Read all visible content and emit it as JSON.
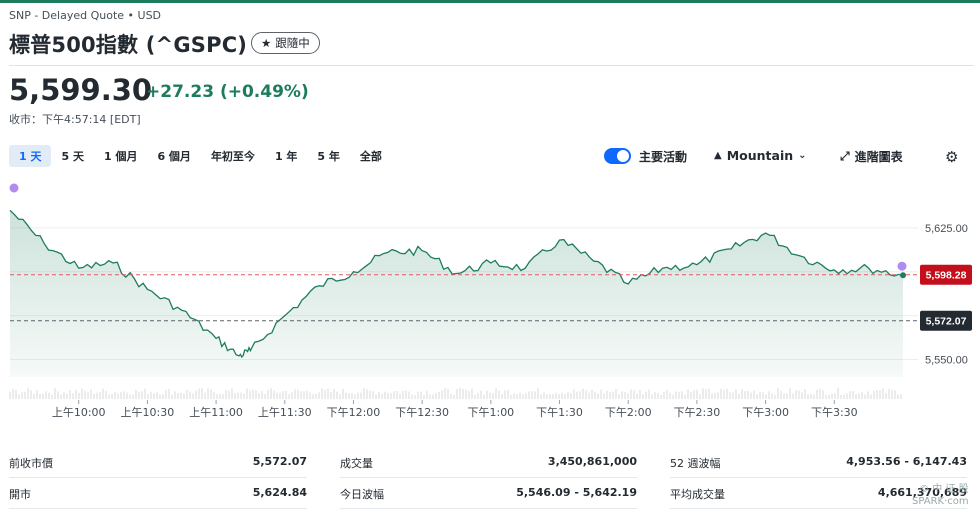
{
  "header": {
    "exchange": "SNP - Delayed Quote • USD",
    "title": "標普500指數 (^GSPC)",
    "follow_label": "跟隨中",
    "price": "5,599.30",
    "change": "+27.23",
    "change_pct": "(+0.49%)",
    "market_status": "收市：下午4:57:14 [EDT]"
  },
  "ranges": [
    {
      "label": "1 天",
      "active": true
    },
    {
      "label": "5 天",
      "active": false
    },
    {
      "label": "1 個月",
      "active": false
    },
    {
      "label": "6 個月",
      "active": false
    },
    {
      "label": "年初至今",
      "active": false
    },
    {
      "label": "1 年",
      "active": false
    },
    {
      "label": "5 年",
      "active": false
    },
    {
      "label": "全部",
      "active": false
    }
  ],
  "controls": {
    "toggle_label": "主要活動",
    "chart_type": "Mountain",
    "advanced": "進階圖表"
  },
  "colors": {
    "up": "#1d7c5e",
    "accent": "#0f69ff",
    "current_price_flag": "#c30f1c",
    "prev_close_flag": "#232a31",
    "event_dot": "#b18cf0"
  },
  "chart_data": {
    "type": "area",
    "ylim": [
      5540,
      5650
    ],
    "y_ticks": [
      {
        "value": 5625,
        "label": "5,625.00"
      },
      {
        "value": 5550,
        "label": "5,550.00"
      }
    ],
    "x_ticks": [
      "上午10:00",
      "上午10:30",
      "上午11:00",
      "上午11:30",
      "下午12:00",
      "下午12:30",
      "下午1:00",
      "下午1:30",
      "下午2:00",
      "下午2:30",
      "下午3:00",
      "下午3:30"
    ],
    "current_price": {
      "value": 5598.28,
      "label": "5,598.28"
    },
    "previous_close": {
      "value": 5572.07,
      "label": "5,572.07"
    },
    "series": [
      {
        "x": [
          "09:30",
          "09:45",
          "10:00",
          "10:15",
          "10:30",
          "10:45",
          "11:00",
          "11:10",
          "11:15",
          "11:30",
          "11:45",
          "12:00",
          "12:15",
          "12:30",
          "12:45",
          "13:00",
          "13:15",
          "13:30",
          "13:45",
          "14:00",
          "14:15",
          "14:30",
          "14:45",
          "15:00",
          "15:15",
          "15:30",
          "15:45",
          "16:00"
        ],
        "values": [
          5635,
          5616,
          5602,
          5605,
          5590,
          5578,
          5562,
          5552,
          5555,
          5575,
          5592,
          5600,
          5611,
          5612,
          5599,
          5605,
          5602,
          5618,
          5606,
          5593,
          5602,
          5604,
          5613,
          5622,
          5609,
          5601,
          5602,
          5598
        ]
      }
    ]
  },
  "stats": [
    {
      "label": "前收市價",
      "value": "5,572.07"
    },
    {
      "label": "開市",
      "value": "5,624.84"
    },
    {
      "label": "成交量",
      "value": "3,450,861,000"
    },
    {
      "label": "今日波幅",
      "value": "5,546.09 - 5,642.19"
    },
    {
      "label": "52 週波幅",
      "value": "4,953.56 - 6,147.43"
    },
    {
      "label": "平均成交量",
      "value": "4,661,370,689"
    }
  ],
  "watermark": {
    "line1": "© 中 证 股",
    "line2": "SPARK·com"
  }
}
